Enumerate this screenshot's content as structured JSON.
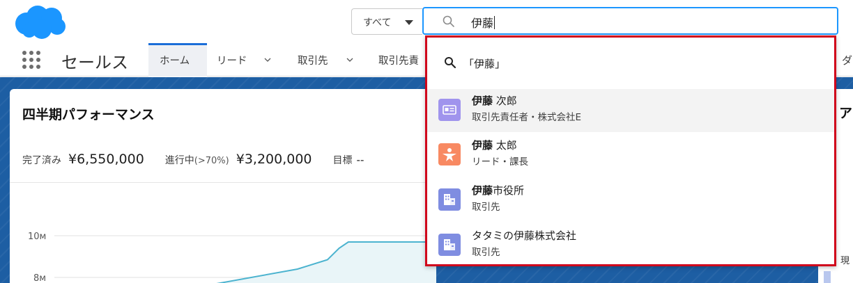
{
  "colors": {
    "brand_blue": "#1b96ff",
    "highlight_red": "#d0021b",
    "contact_icon": "#a094ed",
    "lead_icon": "#f88962",
    "account_icon": "#7f8de1",
    "chart_line": "#4bb3cf"
  },
  "header": {
    "logo_icon": "salesforce-cloud-icon",
    "scope_label": "すべて",
    "search_value": "伊藤"
  },
  "nav": {
    "app_name": "セールス",
    "tabs": [
      {
        "label": "ホーム"
      },
      {
        "label": "リード"
      },
      {
        "label": "取引先"
      },
      {
        "label": "取引先責"
      }
    ],
    "overflow_char": "ダ"
  },
  "dropdown": {
    "query_suggestion": "「伊藤」",
    "results": [
      {
        "bold": "伊藤",
        "rest": " 次郎",
        "subtitle": "取引先責任者・株式会社E",
        "icon": "contact-card-icon"
      },
      {
        "bold": "伊藤",
        "rest": " 太郎",
        "subtitle": "リード・課長",
        "icon": "lead-star-icon"
      },
      {
        "bold": "伊藤",
        "rest": "市役所",
        "subtitle": "取引先",
        "icon": "account-building-icon"
      },
      {
        "bold": "",
        "rest": "タタミの伊藤株式会社",
        "subtitle": "取引先",
        "icon": "account-building-icon"
      }
    ]
  },
  "card": {
    "title": "四半期パフォーマンス",
    "closed_label": "完了済み",
    "closed_value": "¥6,550,000",
    "open_label": "進行中",
    "open_qualifier": "(>70%)",
    "open_value": "¥3,200,000",
    "goal_label": "目標",
    "goal_value": "--"
  },
  "chart_data": {
    "type": "line",
    "y_tick_labels": [
      "10м",
      "8м"
    ],
    "series": [
      {
        "points": [
          [
            0,
            7.6
          ],
          [
            0.4,
            8.4
          ],
          [
            0.53,
            8.85
          ],
          [
            0.58,
            9.4
          ],
          [
            0.62,
            9.7
          ],
          [
            1.0,
            9.7
          ]
        ]
      }
    ]
  },
  "right_card": {
    "title_char": "ア",
    "text_char": "現"
  }
}
